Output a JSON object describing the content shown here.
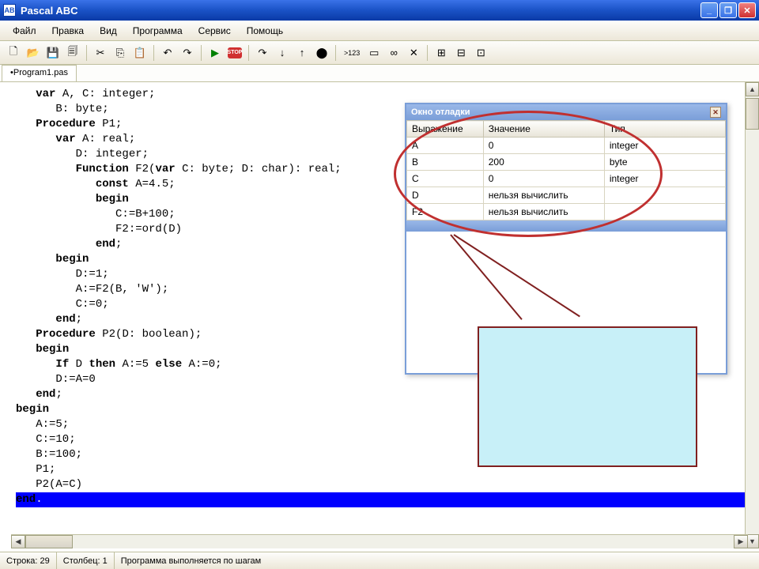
{
  "window": {
    "title": "Pascal ABC",
    "icon_text": "AB"
  },
  "menu": [
    "Файл",
    "Правка",
    "Вид",
    "Программа",
    "Сервис",
    "Помощь"
  ],
  "tab": "•Program1.pas",
  "code_lines": [
    {
      "indent": 3,
      "tokens": [
        {
          "t": "var",
          "kw": true
        },
        {
          "t": " A, C: "
        },
        {
          "t": "integer",
          "kw": false
        },
        {
          "t": ";"
        }
      ]
    },
    {
      "indent": 6,
      "tokens": [
        {
          "t": "B: "
        },
        {
          "t": "byte",
          "kw": false
        },
        {
          "t": ";"
        }
      ]
    },
    {
      "indent": 3,
      "tokens": [
        {
          "t": "Procedure",
          "kw": true
        },
        {
          "t": " P1;"
        }
      ]
    },
    {
      "indent": 6,
      "tokens": [
        {
          "t": "var",
          "kw": true
        },
        {
          "t": " A: "
        },
        {
          "t": "real",
          "kw": false
        },
        {
          "t": ";"
        }
      ]
    },
    {
      "indent": 9,
      "tokens": [
        {
          "t": "D: "
        },
        {
          "t": "integer",
          "kw": false
        },
        {
          "t": ";"
        }
      ]
    },
    {
      "indent": 9,
      "tokens": [
        {
          "t": "Function",
          "kw": true
        },
        {
          "t": " F2("
        },
        {
          "t": "var",
          "kw": true
        },
        {
          "t": " C: "
        },
        {
          "t": "byte",
          "kw": false
        },
        {
          "t": "; D: "
        },
        {
          "t": "char",
          "kw": false
        },
        {
          "t": "): "
        },
        {
          "t": "real",
          "kw": false
        },
        {
          "t": ";"
        }
      ]
    },
    {
      "indent": 12,
      "tokens": [
        {
          "t": "const",
          "kw": true
        },
        {
          "t": " A=4.5;"
        }
      ]
    },
    {
      "indent": 12,
      "tokens": [
        {
          "t": "begin",
          "kw": true
        }
      ]
    },
    {
      "indent": 15,
      "tokens": [
        {
          "t": "C:=B+100;"
        }
      ]
    },
    {
      "indent": 15,
      "tokens": [
        {
          "t": "F2:=ord(D)"
        }
      ]
    },
    {
      "indent": 12,
      "tokens": [
        {
          "t": "end",
          "kw": true
        },
        {
          "t": ";"
        }
      ]
    },
    {
      "indent": 6,
      "tokens": [
        {
          "t": "begin",
          "kw": true
        }
      ]
    },
    {
      "indent": 9,
      "tokens": [
        {
          "t": "D:=1;"
        }
      ]
    },
    {
      "indent": 9,
      "tokens": [
        {
          "t": "A:=F2(B, 'W');"
        }
      ]
    },
    {
      "indent": 9,
      "tokens": [
        {
          "t": "C:=0;"
        }
      ]
    },
    {
      "indent": 6,
      "tokens": [
        {
          "t": "end",
          "kw": true
        },
        {
          "t": ";"
        }
      ]
    },
    {
      "indent": 3,
      "tokens": [
        {
          "t": "Procedure",
          "kw": true
        },
        {
          "t": " P2(D: "
        },
        {
          "t": "boolean",
          "kw": false
        },
        {
          "t": ");"
        }
      ]
    },
    {
      "indent": 3,
      "tokens": [
        {
          "t": "begin",
          "kw": true
        }
      ]
    },
    {
      "indent": 6,
      "tokens": [
        {
          "t": "If",
          "kw": true
        },
        {
          "t": " D "
        },
        {
          "t": "then",
          "kw": true
        },
        {
          "t": " A:=5 "
        },
        {
          "t": "else",
          "kw": true
        },
        {
          "t": " A:=0;"
        }
      ]
    },
    {
      "indent": 6,
      "tokens": [
        {
          "t": "D:=A=0"
        }
      ]
    },
    {
      "indent": 3,
      "tokens": [
        {
          "t": "end",
          "kw": true
        },
        {
          "t": ";"
        }
      ]
    },
    {
      "indent": 0,
      "tokens": [
        {
          "t": "begin",
          "kw": true
        }
      ]
    },
    {
      "indent": 3,
      "tokens": [
        {
          "t": "A:=5;"
        }
      ]
    },
    {
      "indent": 3,
      "tokens": [
        {
          "t": "C:=10;"
        }
      ]
    },
    {
      "indent": 3,
      "tokens": [
        {
          "t": "B:=100;"
        }
      ]
    },
    {
      "indent": 3,
      "tokens": [
        {
          "t": "P1;"
        }
      ]
    },
    {
      "indent": 3,
      "tokens": [
        {
          "t": "P2(A=C)"
        }
      ]
    },
    {
      "indent": 0,
      "tokens": [
        {
          "t": "end",
          "kw": true
        },
        {
          "t": "."
        }
      ],
      "highlight": true
    }
  ],
  "debug": {
    "title": "Окно отладки",
    "headers": [
      "Выражение",
      "Значение",
      "Тип"
    ],
    "rows": [
      {
        "expr": "A",
        "val": "0",
        "type": "integer"
      },
      {
        "expr": "B",
        "val": "200",
        "type": "byte"
      },
      {
        "expr": "C",
        "val": "0",
        "type": "integer"
      },
      {
        "expr": "D",
        "val": "нельзя вычислить",
        "type": ""
      },
      {
        "expr": "F2",
        "val": "нельзя вычислить",
        "type": ""
      }
    ]
  },
  "status": {
    "line_label": "Строка:",
    "line": 29,
    "col_label": "Столбец:",
    "col": 1,
    "msg": "Программа выполняется по шагам"
  },
  "icons": {
    "new": "🗋",
    "open": "📂",
    "save": "💾",
    "saveall": "🗐",
    "cut": "✂",
    "copy": "⎘",
    "paste": "📋",
    "undo": "↶",
    "redo": "↷",
    "run": "▶",
    "stop": "STOP",
    "step_over": "↷",
    "step_into": "↓",
    "step_out": "↑",
    "toggle_bp": "⬤",
    "x123": ">123",
    "win1": "▭",
    "win2": "∞",
    "win3": "✕",
    "t1": "⊞",
    "t2": "⊟",
    "t3": "⊡",
    "min": "_",
    "max": "❐",
    "close": "✕",
    "up": "▲",
    "down": "▼",
    "left": "◀",
    "right": "▶"
  }
}
